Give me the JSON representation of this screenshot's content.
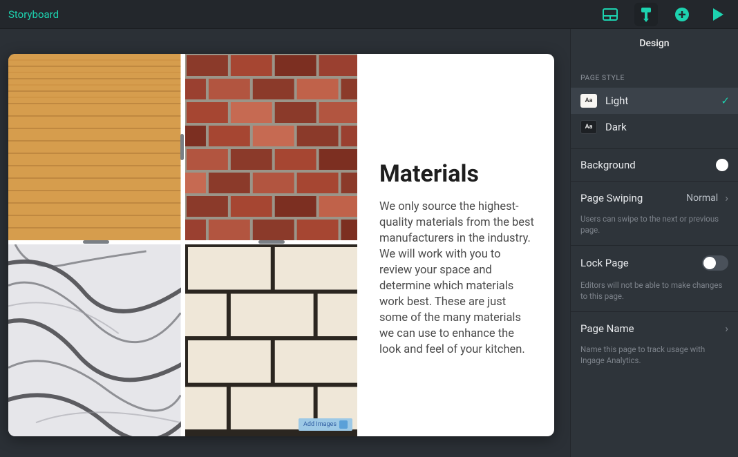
{
  "header": {
    "title": "Storyboard",
    "design_tab": "Design"
  },
  "page_content": {
    "heading": "Materials",
    "body": "We only source the highest-quality materials from the best manufacturers in the industry. We will work with you to review your space and determine which materials work best. These are just some of the many materials we can use to enhance the look and feel of your kitchen.",
    "add_images_label": "Add Images"
  },
  "sidebar": {
    "page_style_label": "PAGE STYLE",
    "light_label": "Light",
    "dark_label": "Dark",
    "swatch_text": "Aa",
    "background_label": "Background",
    "page_swiping_label": "Page Swiping",
    "page_swiping_value": "Normal",
    "page_swiping_hint": "Users can swipe to the next or previous page.",
    "lock_page_label": "Lock Page",
    "lock_page_hint": "Editors will not be able to make changes to this page.",
    "page_name_label": "Page Name",
    "page_name_hint": "Name this page to track usage with Ingage Analytics."
  }
}
